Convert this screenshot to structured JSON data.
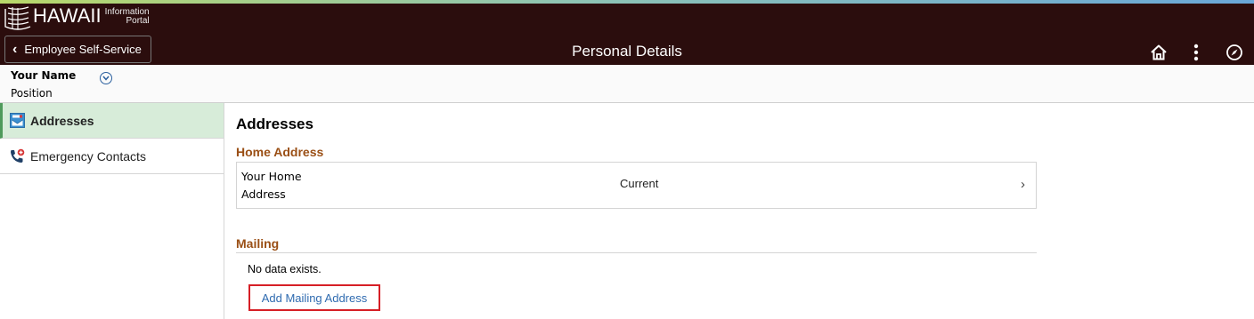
{
  "header": {
    "logo_text": "HAWAII",
    "logo_sub_1": "Information",
    "logo_sub_2": "Portal",
    "back_label": "Employee Self-Service",
    "page_title": "Personal Details",
    "icons": [
      "home-icon",
      "more-options-icon",
      "navbar-icon"
    ]
  },
  "person": {
    "name": "Your Name",
    "position": "Position"
  },
  "sidebar": {
    "items": [
      {
        "label": "Addresses",
        "icon": "addresses-icon",
        "active": true
      },
      {
        "label": "Emergency Contacts",
        "icon": "emergency-contacts-icon",
        "active": false
      }
    ]
  },
  "main": {
    "title": "Addresses",
    "home_section": {
      "heading": "Home Address",
      "address": "Your Home Address",
      "status": "Current"
    },
    "mailing_section": {
      "heading": "Mailing",
      "empty_text": "No data exists.",
      "add_label": "Add Mailing Address"
    }
  },
  "colors": {
    "banner": "#2b0d0d",
    "section_heading": "#9a4f15",
    "active_tab": "#d7ecd9",
    "link": "#2f6bb0",
    "highlight": "#d61f26"
  }
}
